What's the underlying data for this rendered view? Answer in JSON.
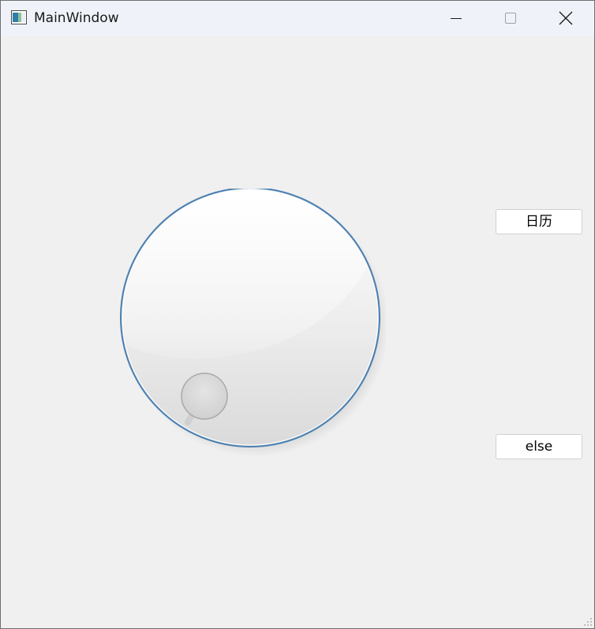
{
  "window": {
    "title": "MainWindow",
    "controls": {
      "minimize_icon": "minimize-icon",
      "maximize_icon": "maximize-icon",
      "close_icon": "close-icon"
    }
  },
  "main": {
    "dial": {
      "icon": "rotary-dial"
    },
    "buttons": {
      "calendar_label": "日历",
      "else_label": "else"
    }
  },
  "colors": {
    "window_background": "#f0f0f0",
    "titlebar_background": "#eff3f9",
    "dial_ring": "#4a7fb0"
  }
}
